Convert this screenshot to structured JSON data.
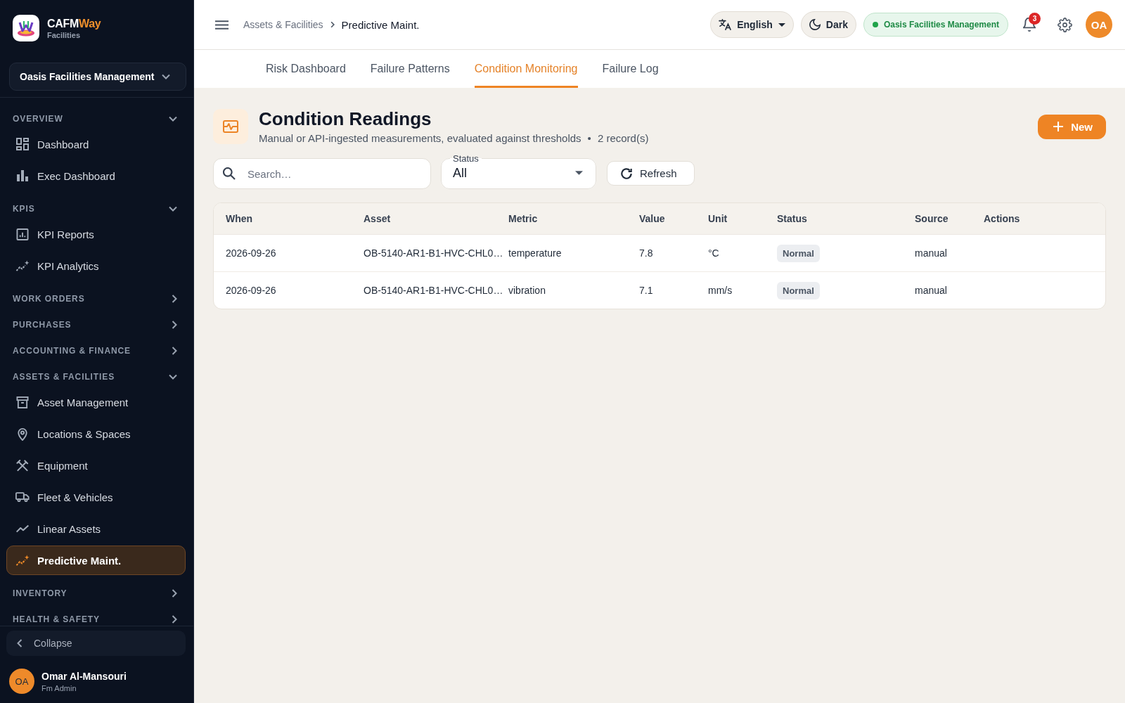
{
  "sidebar": {
    "brand": {
      "name": "CAFM",
      "accent": "Way",
      "subtitle": "Facilities"
    },
    "organization": "Oasis Facilities Management",
    "sections": [
      {
        "label": "OVERVIEW",
        "expanded": true,
        "items": [
          {
            "label": "Dashboard",
            "selected": false
          },
          {
            "label": "Exec Dashboard",
            "selected": false
          }
        ]
      },
      {
        "label": "KPIS",
        "expanded": true,
        "items": [
          {
            "label": "KPI Reports",
            "selected": false
          },
          {
            "label": "KPI Analytics",
            "selected": false
          }
        ]
      },
      {
        "label": "WORK ORDERS",
        "expanded": false
      },
      {
        "label": "PURCHASES",
        "expanded": false
      },
      {
        "label": "ACCOUNTING & FINANCE",
        "expanded": false
      },
      {
        "label": "ASSETS & FACILITIES",
        "expanded": true,
        "items": [
          {
            "label": "Asset Management",
            "selected": false
          },
          {
            "label": "Locations & Spaces",
            "selected": false
          },
          {
            "label": "Equipment",
            "selected": false
          },
          {
            "label": "Fleet & Vehicles",
            "selected": false
          },
          {
            "label": "Linear Assets",
            "selected": false
          },
          {
            "label": "Predictive Maint.",
            "selected": true
          }
        ]
      },
      {
        "label": "INVENTORY",
        "expanded": false
      },
      {
        "label": "HEALTH & SAFETY",
        "expanded": false
      }
    ],
    "collapse": "Collapse",
    "user": {
      "initials": "OA",
      "name": "Omar Al-Mansouri",
      "role": "Fm Admin"
    }
  },
  "topbar": {
    "breadcrumb": [
      {
        "label": "Assets & Facilities",
        "current": false
      },
      {
        "label": "Predictive Maint.",
        "current": true
      }
    ],
    "language": "English",
    "theme": "Dark",
    "organization": "Oasis Facilities Management",
    "notification_count": "3",
    "avatar_initials": "OA"
  },
  "tabs": [
    {
      "label": "Risk Dashboard",
      "selected": false
    },
    {
      "label": "Failure Patterns",
      "selected": false
    },
    {
      "label": "Condition Monitoring",
      "selected": true
    },
    {
      "label": "Failure Log",
      "selected": false
    }
  ],
  "page": {
    "title": "Condition Readings",
    "subtitle": "Manual or API-ingested measurements, evaluated against thresholds",
    "separator": "•",
    "record_count": "2 record(s)",
    "new_button": "New"
  },
  "filters": {
    "search": {
      "placeholder": "Search…"
    },
    "status": {
      "label": "Status",
      "value": "All"
    },
    "refresh": "Refresh"
  },
  "table": {
    "columns": [
      "When",
      "Asset",
      "Metric",
      "Value",
      "Unit",
      "Status",
      "Source",
      "Actions"
    ],
    "rows": [
      {
        "when": "2026-09-26",
        "asset": "OB-5140-AR1-B1-HVC-CHL0…",
        "metric": "temperature",
        "value": "7.8",
        "unit": "°C",
        "status": "Normal",
        "source": "manual"
      },
      {
        "when": "2026-09-26",
        "asset": "OB-5140-AR1-B1-HVC-CHL0…",
        "metric": "vibration",
        "value": "7.1",
        "unit": "mm/s",
        "status": "Normal",
        "source": "manual"
      }
    ]
  }
}
